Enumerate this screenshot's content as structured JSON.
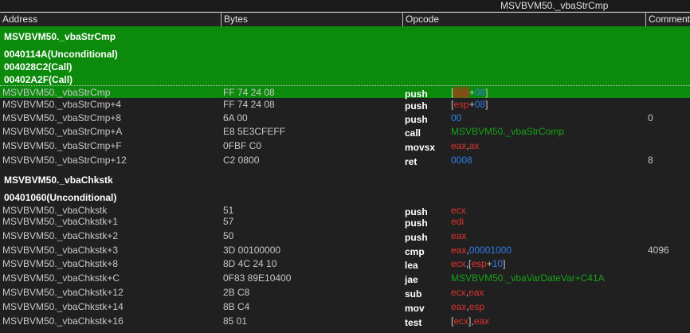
{
  "window": {
    "title": "MSVBVM50._vbaStrCmp"
  },
  "columns": [
    "Address",
    "Bytes",
    "Opcode",
    "Comment"
  ],
  "block1": {
    "name": "MSVBVM50._vbaStrCmp",
    "refs": [
      "0040114A(Unconditional)",
      "004028C2(Call)",
      "00402A2F(Call)"
    ],
    "rows": [
      {
        "addr": "MSVBVM50._vbaStrCmp",
        "bytes": "FF 74 24 08",
        "mnem": "push",
        "op": [
          "[",
          "esp",
          "+",
          "08",
          "]"
        ],
        "comment": ""
      },
      {
        "addr": "MSVBVM50._vbaStrCmp+4",
        "bytes": "FF 74 24 08",
        "mnem": "push",
        "op": [
          "[",
          "esp",
          "+",
          "08",
          "]"
        ],
        "comment": ""
      },
      {
        "addr": "MSVBVM50._vbaStrCmp+8",
        "bytes": "6A 00",
        "mnem": "push",
        "op": [
          "00"
        ],
        "comment": "0"
      },
      {
        "addr": "MSVBVM50._vbaStrCmp+A",
        "bytes": "E8 5E3CFEFF",
        "mnem": "call",
        "op": [
          "MSVBVM50._vbaStrComp"
        ],
        "comment": ""
      },
      {
        "addr": "MSVBVM50._vbaStrCmp+F",
        "bytes": "0FBF C0",
        "mnem": "movsx",
        "op": [
          "eax",
          ",",
          "ax"
        ],
        "comment": ""
      },
      {
        "addr": "MSVBVM50._vbaStrCmp+12",
        "bytes": "C2 0800",
        "mnem": "ret",
        "op": [
          "0008"
        ],
        "comment": "8"
      }
    ]
  },
  "block2": {
    "name": "MSVBVM50._vbaChkstk",
    "refs": [
      "00401060(Unconditional)"
    ],
    "rows": [
      {
        "addr": "MSVBVM50._vbaChkstk",
        "bytes": "51",
        "mnem": "push",
        "op": [
          "ecx"
        ],
        "comment": ""
      },
      {
        "addr": "MSVBVM50._vbaChkstk+1",
        "bytes": "57",
        "mnem": "push",
        "op": [
          "edi"
        ],
        "comment": ""
      },
      {
        "addr": "MSVBVM50._vbaChkstk+2",
        "bytes": "50",
        "mnem": "push",
        "op": [
          "eax"
        ],
        "comment": ""
      },
      {
        "addr": "MSVBVM50._vbaChkstk+3",
        "bytes": "3D 00100000",
        "mnem": "cmp",
        "op": [
          "eax",
          ",",
          "00001000"
        ],
        "comment": "4096"
      },
      {
        "addr": "MSVBVM50._vbaChkstk+8",
        "bytes": "8D 4C 24 10",
        "mnem": "lea",
        "op": [
          "ecx",
          ",[",
          "esp",
          "+",
          "10",
          "]"
        ],
        "comment": ""
      },
      {
        "addr": "MSVBVM50._vbaChkstk+C",
        "bytes": "0F83 89E10400",
        "mnem": "jae",
        "op": [
          "MSVBVM50._vbaVarDateVar+C41A"
        ],
        "comment": ""
      },
      {
        "addr": "MSVBVM50._vbaChkstk+12",
        "bytes": "2B C8",
        "mnem": "sub",
        "op": [
          "ecx",
          ",",
          "eax"
        ],
        "comment": ""
      },
      {
        "addr": "MSVBVM50._vbaChkstk+14",
        "bytes": "8B C4",
        "mnem": "mov",
        "op": [
          "eax",
          ",",
          "esp"
        ],
        "comment": ""
      },
      {
        "addr": "MSVBVM50._vbaChkstk+16",
        "bytes": "85 01",
        "mnem": "test",
        "op": [
          "[",
          "ecx",
          "]",
          ",",
          "eax"
        ],
        "comment": ""
      }
    ]
  },
  "colors": {
    "register": "#e0332d",
    "number": "#2f7fe8",
    "symbol": "#17a317",
    "highlight": "#0c8a0c"
  }
}
